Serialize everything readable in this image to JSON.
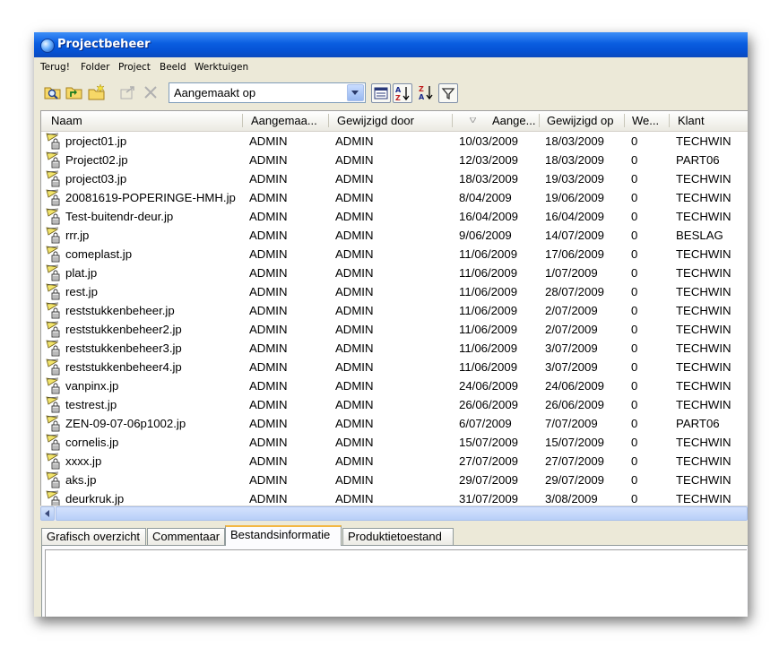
{
  "window": {
    "title": "Projectbeheer"
  },
  "menu": [
    "Terug!",
    "Folder",
    "Project",
    "Beeld",
    "Werktuigen"
  ],
  "toolbar": {
    "sort_field": "Aangemaakt op",
    "icons": [
      "search-folder-icon",
      "folder-up-icon",
      "new-folder-icon",
      "move-icon",
      "delete-icon",
      "details-view-icon",
      "sort-ascending-icon",
      "sort-descending-icon",
      "filter-icon"
    ]
  },
  "columns": [
    "Naam",
    "Aangemaa...",
    "Gewijzigd door",
    "Aange...",
    "Gewijzigd op",
    "We...",
    "Klant"
  ],
  "rows": [
    {
      "naam": "project01.jp",
      "aangemaakt_door": "ADMIN",
      "gewijzigd_door": "ADMIN",
      "aangemaakt_op": "10/03/2009",
      "gewijzigd_op": "18/03/2009",
      "we": "0",
      "klant": "TECHWIN"
    },
    {
      "naam": "Project02.jp",
      "aangemaakt_door": "ADMIN",
      "gewijzigd_door": "ADMIN",
      "aangemaakt_op": "12/03/2009",
      "gewijzigd_op": "18/03/2009",
      "we": "0",
      "klant": "PART06"
    },
    {
      "naam": "project03.jp",
      "aangemaakt_door": "ADMIN",
      "gewijzigd_door": "ADMIN",
      "aangemaakt_op": "18/03/2009",
      "gewijzigd_op": "19/03/2009",
      "we": "0",
      "klant": "TECHWIN"
    },
    {
      "naam": "20081619-POPERINGE-HMH.jp",
      "aangemaakt_door": "ADMIN",
      "gewijzigd_door": "ADMIN",
      "aangemaakt_op": "8/04/2009",
      "gewijzigd_op": "19/06/2009",
      "we": "0",
      "klant": "TECHWIN"
    },
    {
      "naam": "Test-buitendr-deur.jp",
      "aangemaakt_door": "ADMIN",
      "gewijzigd_door": "ADMIN",
      "aangemaakt_op": "16/04/2009",
      "gewijzigd_op": "16/04/2009",
      "we": "0",
      "klant": "TECHWIN"
    },
    {
      "naam": "rrr.jp",
      "aangemaakt_door": "ADMIN",
      "gewijzigd_door": "ADMIN",
      "aangemaakt_op": "9/06/2009",
      "gewijzigd_op": "14/07/2009",
      "we": "0",
      "klant": "BESLAG"
    },
    {
      "naam": "comeplast.jp",
      "aangemaakt_door": "ADMIN",
      "gewijzigd_door": "ADMIN",
      "aangemaakt_op": "11/06/2009",
      "gewijzigd_op": "17/06/2009",
      "we": "0",
      "klant": "TECHWIN"
    },
    {
      "naam": "plat.jp",
      "aangemaakt_door": "ADMIN",
      "gewijzigd_door": "ADMIN",
      "aangemaakt_op": "11/06/2009",
      "gewijzigd_op": "1/07/2009",
      "we": "0",
      "klant": "TECHWIN"
    },
    {
      "naam": "rest.jp",
      "aangemaakt_door": "ADMIN",
      "gewijzigd_door": "ADMIN",
      "aangemaakt_op": "11/06/2009",
      "gewijzigd_op": "28/07/2009",
      "we": "0",
      "klant": "TECHWIN"
    },
    {
      "naam": "reststukkenbeheer.jp",
      "aangemaakt_door": "ADMIN",
      "gewijzigd_door": "ADMIN",
      "aangemaakt_op": "11/06/2009",
      "gewijzigd_op": "2/07/2009",
      "we": "0",
      "klant": "TECHWIN"
    },
    {
      "naam": "reststukkenbeheer2.jp",
      "aangemaakt_door": "ADMIN",
      "gewijzigd_door": "ADMIN",
      "aangemaakt_op": "11/06/2009",
      "gewijzigd_op": "2/07/2009",
      "we": "0",
      "klant": "TECHWIN"
    },
    {
      "naam": "reststukkenbeheer3.jp",
      "aangemaakt_door": "ADMIN",
      "gewijzigd_door": "ADMIN",
      "aangemaakt_op": "11/06/2009",
      "gewijzigd_op": "3/07/2009",
      "we": "0",
      "klant": "TECHWIN"
    },
    {
      "naam": "reststukkenbeheer4.jp",
      "aangemaakt_door": "ADMIN",
      "gewijzigd_door": "ADMIN",
      "aangemaakt_op": "11/06/2009",
      "gewijzigd_op": "3/07/2009",
      "we": "0",
      "klant": "TECHWIN"
    },
    {
      "naam": "vanpinx.jp",
      "aangemaakt_door": "ADMIN",
      "gewijzigd_door": "ADMIN",
      "aangemaakt_op": "24/06/2009",
      "gewijzigd_op": "24/06/2009",
      "we": "0",
      "klant": "TECHWIN"
    },
    {
      "naam": "testrest.jp",
      "aangemaakt_door": "ADMIN",
      "gewijzigd_door": "ADMIN",
      "aangemaakt_op": "26/06/2009",
      "gewijzigd_op": "26/06/2009",
      "we": "0",
      "klant": "TECHWIN"
    },
    {
      "naam": "ZEN-09-07-06p1002.jp",
      "aangemaakt_door": "ADMIN",
      "gewijzigd_door": "ADMIN",
      "aangemaakt_op": "6/07/2009",
      "gewijzigd_op": "7/07/2009",
      "we": "0",
      "klant": "PART06"
    },
    {
      "naam": "cornelis.jp",
      "aangemaakt_door": "ADMIN",
      "gewijzigd_door": "ADMIN",
      "aangemaakt_op": "15/07/2009",
      "gewijzigd_op": "15/07/2009",
      "we": "0",
      "klant": "TECHWIN"
    },
    {
      "naam": "xxxx.jp",
      "aangemaakt_door": "ADMIN",
      "gewijzigd_door": "ADMIN",
      "aangemaakt_op": "27/07/2009",
      "gewijzigd_op": "27/07/2009",
      "we": "0",
      "klant": "TECHWIN"
    },
    {
      "naam": "aks.jp",
      "aangemaakt_door": "ADMIN",
      "gewijzigd_door": "ADMIN",
      "aangemaakt_op": "29/07/2009",
      "gewijzigd_op": "29/07/2009",
      "we": "0",
      "klant": "TECHWIN"
    },
    {
      "naam": "deurkruk.jp",
      "aangemaakt_door": "ADMIN",
      "gewijzigd_door": "ADMIN",
      "aangemaakt_op": "31/07/2009",
      "gewijzigd_op": "3/08/2009",
      "we": "0",
      "klant": "TECHWIN"
    }
  ],
  "tabs": [
    "Grafisch overzicht",
    "Commentaar",
    "Bestandsinformatie",
    "Produktietoestand"
  ],
  "active_tab": "Bestandsinformatie",
  "colors": {
    "titlebar": "#0a5de0",
    "active_tab_highlight": "#f3b743"
  }
}
